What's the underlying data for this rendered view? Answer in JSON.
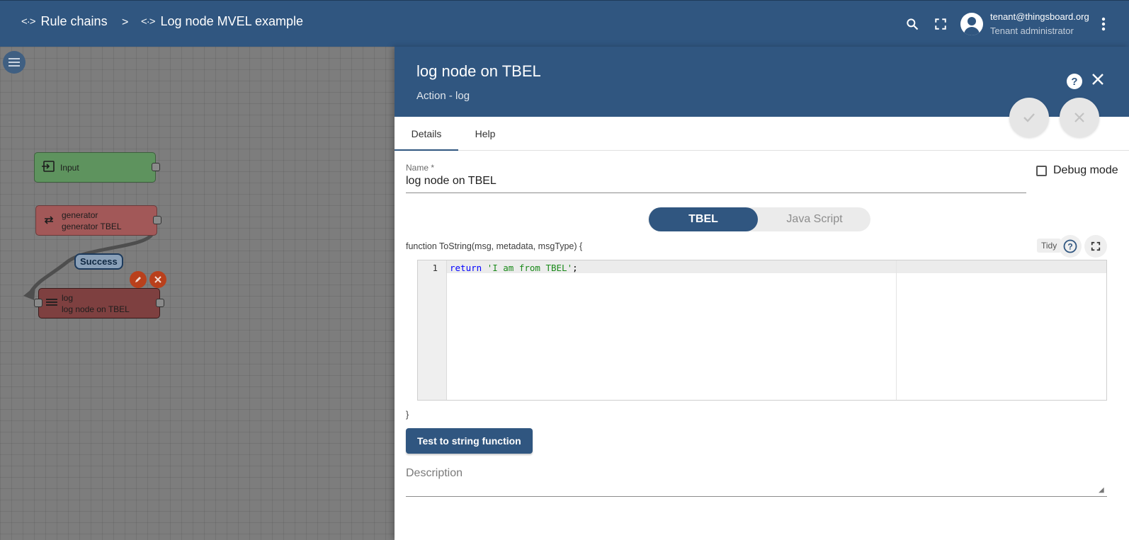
{
  "header": {
    "breadcrumb_root": "Rule chains",
    "breadcrumb_separator": ">",
    "breadcrumb_current": "Log node MVEL example",
    "breadcrumb_icon": "<·>",
    "user_email": "tenant@thingsboard.org",
    "user_role": "Tenant administrator",
    "icons": [
      "search-icon",
      "fullscreen-icon",
      "account-icon",
      "more-vert-icon"
    ]
  },
  "canvas": {
    "nodes": [
      {
        "type": "Input",
        "name": ""
      },
      {
        "type": "generator",
        "name": "generator TBEL"
      },
      {
        "type": "log",
        "name": "log node on TBEL"
      }
    ],
    "link_label": "Success"
  },
  "panel": {
    "title": "log node on TBEL",
    "subtitle": "Action - log",
    "tabs": [
      "Details",
      "Help"
    ],
    "name_label": "Name *",
    "name_value": "log node on TBEL",
    "debug_label": "Debug mode",
    "debug_checked": false,
    "lang_options": [
      "TBEL",
      "Java Script"
    ],
    "lang_selected": "TBEL",
    "function_signature": "function ToString(msg, metadata, msgType) {",
    "tidy_label": "Tidy",
    "code_line_number": "1",
    "code_keyword": "return",
    "code_string": "'I am from TBEL'",
    "code_end": ";",
    "closing_brace": "}",
    "test_button": "Test to string function",
    "description_label": "Description"
  },
  "colors": {
    "primary": "#305680",
    "input_node": "#5e935e",
    "generator_node": "#a25858",
    "log_node": "#7e4040"
  }
}
